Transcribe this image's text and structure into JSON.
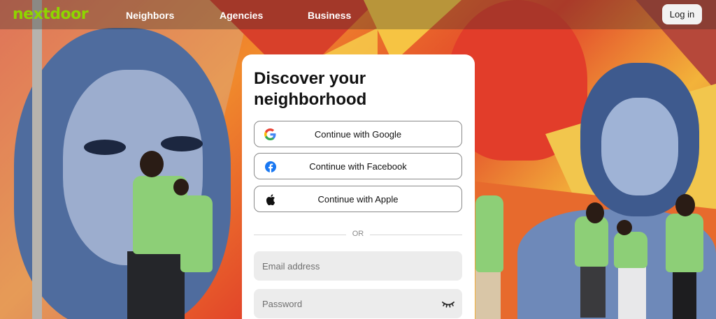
{
  "nav": {
    "logo": "nextdoor",
    "links": [
      "Neighbors",
      "Agencies",
      "Business"
    ],
    "login_label": "Log in"
  },
  "card": {
    "title": "Discover your neighborhood",
    "google_label": "Continue with Google",
    "facebook_label": "Continue with Facebook",
    "apple_label": "Continue with Apple",
    "divider_text": "OR",
    "email_placeholder": "Email address",
    "password_placeholder": "Password"
  },
  "icons": {
    "google": "google-icon",
    "facebook": "facebook-icon",
    "apple": "apple-icon",
    "password_toggle": "eye-closed-icon"
  },
  "colors": {
    "brand_green": "#8ed500",
    "facebook_blue": "#1877f2"
  }
}
